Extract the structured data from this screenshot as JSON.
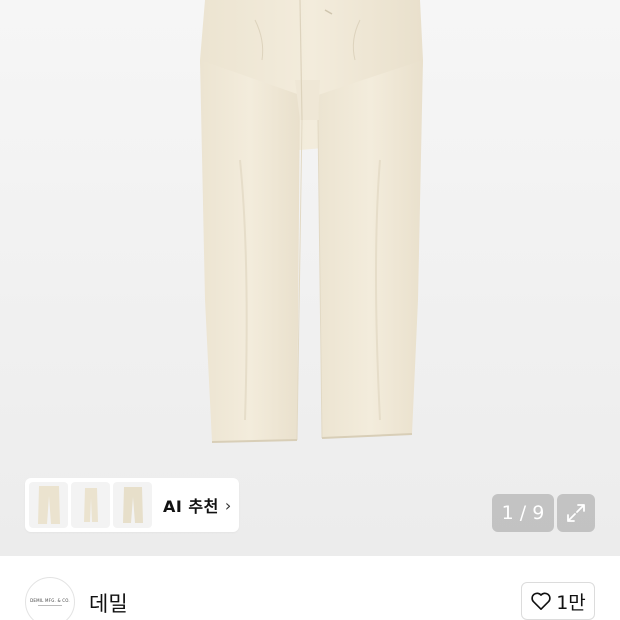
{
  "gallery": {
    "counter_text": "1 / 9",
    "ai_recommend_label": "AI 추천",
    "thumbnails": [
      "pants-front",
      "pants-side",
      "pants-back"
    ]
  },
  "brand": {
    "name": "데밀",
    "logo_text": "DEMIL MFG. & CO."
  },
  "like": {
    "count": "1만"
  },
  "colors": {
    "product": "#f1ead9",
    "overlay": "#a0a0a0"
  }
}
